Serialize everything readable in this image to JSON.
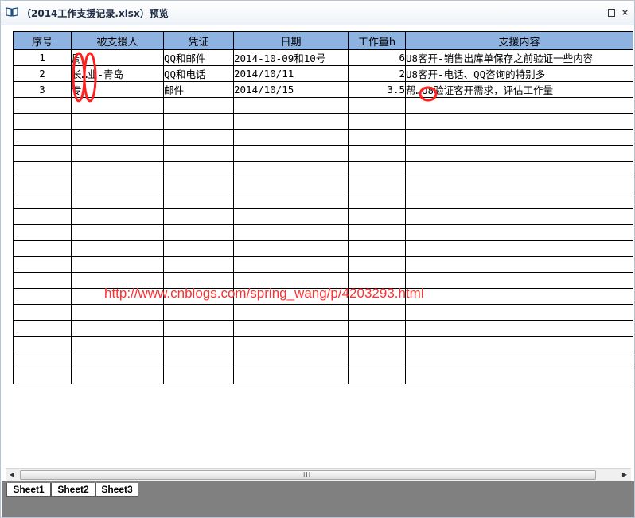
{
  "window": {
    "title": "（2014工作支援记录.xlsx）预览",
    "maximize_label": "□",
    "close_label": "×"
  },
  "sheet": {
    "headers": [
      "序号",
      "被支援人",
      "凭证",
      "日期",
      "工作量h",
      "支援内容"
    ],
    "rows": [
      [
        "1",
        "周",
        "QQ和邮件",
        "2014-10-09和10号",
        "6",
        "U8客开-销售出库单保存之前验证一些内容"
      ],
      [
        "2",
        "长…业-青岛",
        "QQ和电话",
        "2014/10/11",
        "2",
        "U8客开-电话、QQ咨询的特别多"
      ],
      [
        "3",
        "专",
        "邮件",
        "2014/10/15",
        "3.5",
        "帮…U8验证客开需求，评估工作量"
      ]
    ],
    "empty_row_count": 18
  },
  "watermark": "http://www.cnblogs.com/spring_wang/p/4203293.html",
  "scrollbar": {
    "grip": "III"
  },
  "tabs": [
    "Sheet1",
    "Sheet2",
    "Sheet3"
  ],
  "colors": {
    "header_bg": "#8fb3e0",
    "annotation": "#ff2020",
    "tabbar_bg": "#808080"
  }
}
